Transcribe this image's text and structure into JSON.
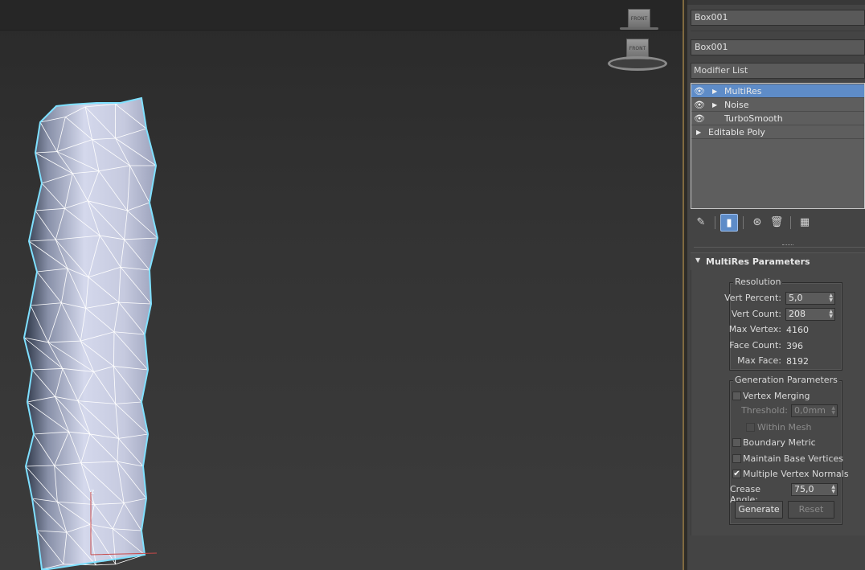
{
  "viewport": {
    "viewcube_top_label": "FRONT",
    "viewcube_bottom_label": "FRONT",
    "axis_label": "z"
  },
  "command_panel": {
    "object_name_top": "Box001",
    "object_name": "Box001",
    "modifier_list_label": "Modifier List",
    "stack": [
      {
        "label": "MultiRes",
        "eye": true,
        "expander": true,
        "selected": true
      },
      {
        "label": "Noise",
        "eye": true,
        "expander": true,
        "selected": false
      },
      {
        "label": "TurboSmooth",
        "eye": true,
        "expander": false,
        "selected": false
      },
      {
        "label": "Editable Poly",
        "eye": false,
        "expander": true,
        "selected": false
      }
    ],
    "stack_toolbar": [
      "pin-stack",
      "show-end-result",
      "make-unique",
      "remove-modifier",
      "configure-modifier-sets"
    ]
  },
  "multires": {
    "rollout_title": "MultiRes Parameters",
    "resolution": {
      "title": "Resolution",
      "vert_percent_label": "Vert Percent:",
      "vert_percent_value": "5,0",
      "vert_count_label": "Vert Count:",
      "vert_count_value": "208",
      "max_vertex_label": "Max Vertex:",
      "max_vertex_value": "4160",
      "face_count_label": "Face Count:",
      "face_count_value": "396",
      "max_face_label": "Max Face:",
      "max_face_value": "8192"
    },
    "generation": {
      "title": "Generation Parameters",
      "vertex_merging_label": "Vertex Merging",
      "vertex_merging_checked": false,
      "threshold_label": "Threshold:",
      "threshold_value": "0,0mm",
      "within_mesh_label": "Within Mesh",
      "within_mesh_checked": false,
      "boundary_metric_label": "Boundary Metric",
      "boundary_metric_checked": false,
      "maintain_base_label": "Maintain Base Vertices",
      "maintain_base_checked": false,
      "multiple_normals_label": "Multiple Vertex Normals",
      "multiple_normals_checked": true,
      "crease_angle_label": "Crease Angle:",
      "crease_angle_value": "75,0",
      "generate_label": "Generate",
      "reset_label": "Reset"
    }
  },
  "colors": {
    "selection_blue": "#5e8cc8",
    "mesh_outline": "#7fe0ff",
    "panel_bg": "#444444"
  }
}
